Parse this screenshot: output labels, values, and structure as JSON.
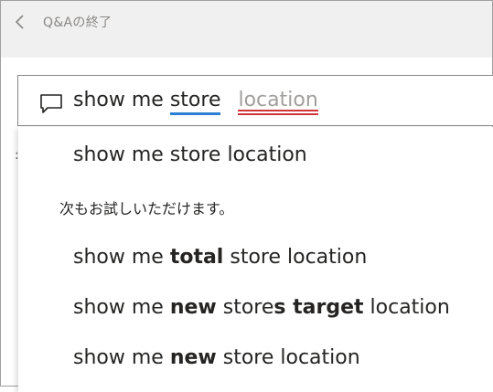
{
  "header": {
    "back_label": "Q&Aの終了"
  },
  "question": {
    "typed": "show me",
    "recognized": "store",
    "ghost": "location"
  },
  "dropdown": {
    "top_suggestion": "show me store  location",
    "hint": "次もお試しいただけます。",
    "suggestions": [
      {
        "pre": "show me ",
        "bold": "total",
        "post": " store  location",
        "bold2": "",
        "post2": ""
      },
      {
        "pre": "show me ",
        "bold": "new",
        "post": " store",
        "bold2": "s target",
        "post2": "  location"
      },
      {
        "pre": "show me ",
        "bold": "new",
        "post": " store  location",
        "bold2": "",
        "post2": ""
      }
    ]
  },
  "colors": {
    "accent_blue": "#2b7fd4",
    "spell_red": "#d13438"
  }
}
